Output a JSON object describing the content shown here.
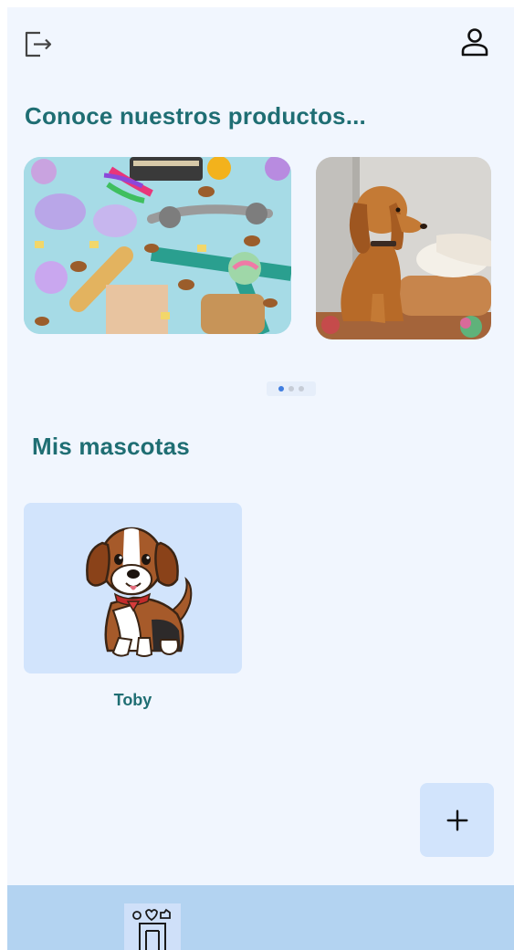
{
  "header": {
    "logout_icon": "logout-icon",
    "profile_icon": "person-icon"
  },
  "products": {
    "title": "Conoce nuestros productos...",
    "cards": [
      {
        "image": "pet-toys-and-treats-photo"
      },
      {
        "image": "spaniel-dog-on-bed-photo"
      }
    ],
    "pagination": {
      "count": 3,
      "active": 0
    }
  },
  "pets": {
    "title": "Mis mascotas",
    "items": [
      {
        "name": "Toby",
        "image": "beagle-puppy-illustration"
      }
    ]
  },
  "fab": {
    "label": "+"
  },
  "bottom_nav": {
    "items": [
      {
        "icon": "pet-care-icon",
        "selected": true
      }
    ]
  },
  "colors": {
    "background": "#f1f6fe",
    "title": "#1f6e73",
    "card": "#d2e4fc",
    "bottom_bar": "#b3d3f1",
    "dot_active": "#3f7de0"
  }
}
